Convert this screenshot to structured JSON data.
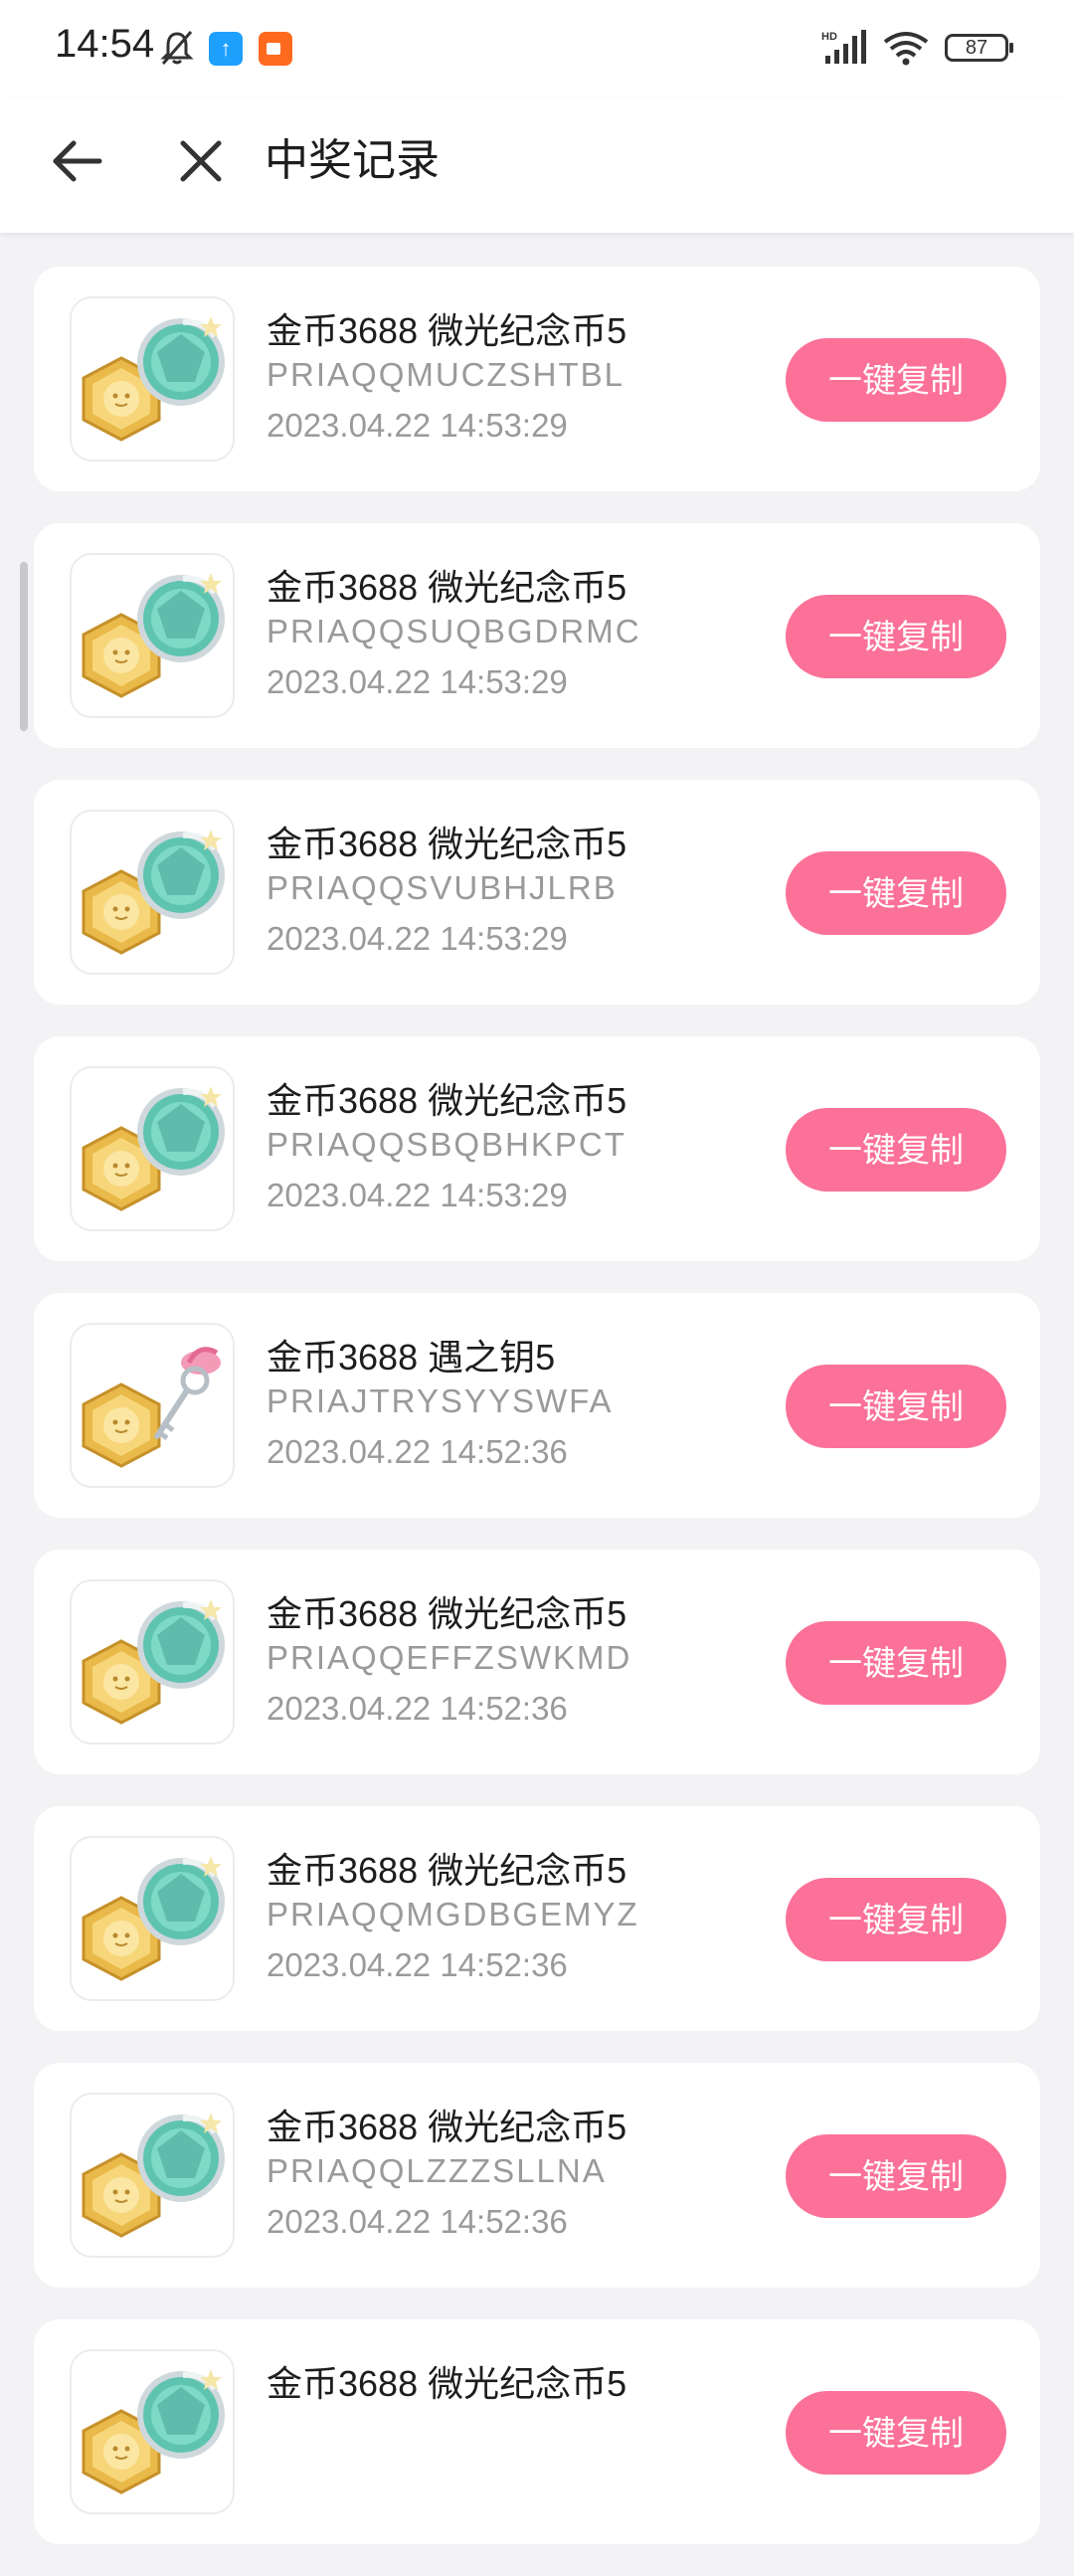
{
  "status_bar": {
    "time": "14:54",
    "battery": "87",
    "network": "HD"
  },
  "header": {
    "title": "中奖记录"
  },
  "copy_label": "一键复制",
  "records": [
    {
      "name": "金币3688 微光纪念币5",
      "code": "PRIAQQMUCZSHTBL",
      "time": "2023.04.22 14:53:29",
      "icon": "coin-with-teal-medal-icon"
    },
    {
      "name": "金币3688 微光纪念币5",
      "code": "PRIAQQSUQBGDRMC",
      "time": "2023.04.22 14:53:29",
      "icon": "coin-with-teal-medal-icon"
    },
    {
      "name": "金币3688 微光纪念币5",
      "code": "PRIAQQSVUBHJLRB",
      "time": "2023.04.22 14:53:29",
      "icon": "coin-with-teal-medal-icon"
    },
    {
      "name": "金币3688 微光纪念币5",
      "code": "PRIAQQSBQBHKPCT",
      "time": "2023.04.22 14:53:29",
      "icon": "coin-with-teal-medal-icon"
    },
    {
      "name": "金币3688 遇之钥5",
      "code": "PRIAJTRYSYYSWFA",
      "time": "2023.04.22 14:52:36",
      "icon": "coin-with-key-icon"
    },
    {
      "name": "金币3688 微光纪念币5",
      "code": "PRIAQQEFFZSWKMD",
      "time": "2023.04.22 14:52:36",
      "icon": "coin-with-teal-medal-icon"
    },
    {
      "name": "金币3688 微光纪念币5",
      "code": "PRIAQQMGDBGEMYZ",
      "time": "2023.04.22 14:52:36",
      "icon": "coin-with-teal-medal-icon"
    },
    {
      "name": "金币3688 微光纪念币5",
      "code": "PRIAQQLZZZSLLNA",
      "time": "2023.04.22 14:52:36",
      "icon": "coin-with-teal-medal-icon"
    },
    {
      "name": "金币3688 微光纪念币5",
      "code": "",
      "time": "",
      "icon": "coin-with-teal-medal-icon"
    }
  ],
  "colors": {
    "accent": "#fb7198",
    "background": "#f3f3f5",
    "card": "#ffffff",
    "secondary_text": "#9a9a9a"
  }
}
